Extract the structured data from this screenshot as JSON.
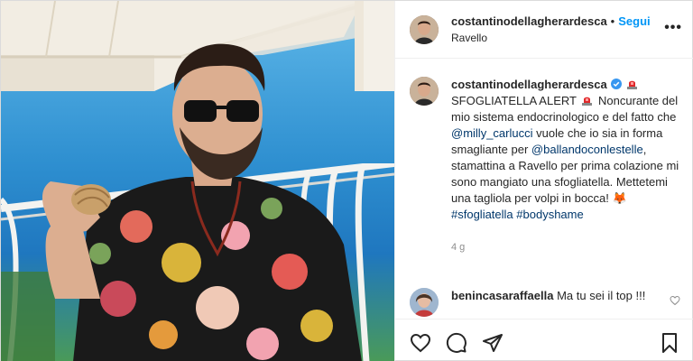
{
  "header": {
    "username": "costantinodellagherardesca",
    "separator": "•",
    "follow_label": "Segui",
    "location": "Ravello",
    "more_label": "•••"
  },
  "caption": {
    "username": "costantinodellagherardesca",
    "text_1": "SFOGLIATELLA ALERT",
    "text_2": "Noncurante del mio sistema endocrinologico e del fatto che",
    "mention_1": "@milly_carlucci",
    "text_3": "vuole che io sia in forma smagliante per",
    "mention_2": "@ballandoconlestelle",
    "text_4": ", stamattina a Ravello per prima colazione mi sono mangiato una sfogliatella. Mettetemi una tagliola per volpi in bocca!",
    "emoji_fox": "🦊",
    "hashtag_1": "#sfogliatella",
    "hashtag_2": "#bodyshame",
    "time": "4 g"
  },
  "comment": {
    "username": "benincasaraffaella",
    "text": "Ma tu sei il top !!!"
  },
  "icons": {
    "verified": "verified-badge-icon",
    "siren": "rotating-light-icon",
    "like": "heart-icon",
    "comment": "speech-bubble-icon",
    "share": "paper-plane-icon",
    "save": "bookmark-icon"
  },
  "colors": {
    "follow": "#0095f6",
    "link": "#00376b",
    "verified": "#3897f0",
    "meta": "#8e8e8e"
  }
}
